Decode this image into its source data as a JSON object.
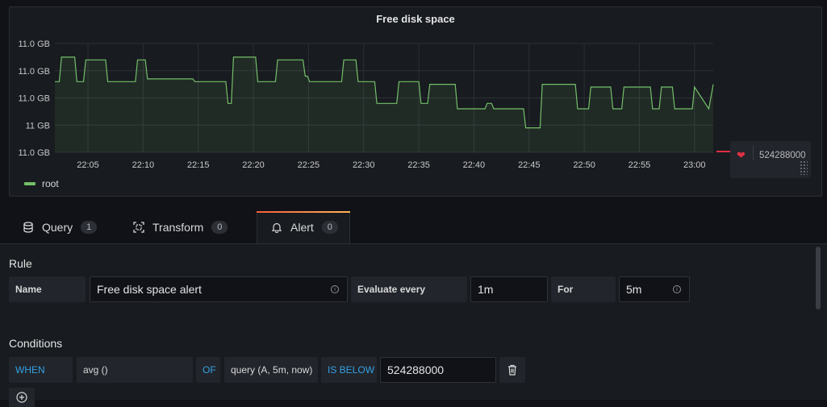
{
  "panel": {
    "title": "Free disk space"
  },
  "chart_data": {
    "type": "area",
    "title": "Free disk space",
    "y_tick_labels": [
      "11.0 GB",
      "11.0 GB",
      "11.0 GB",
      "11 GB",
      "11.0 GB"
    ],
    "x_tick_labels": [
      "22:05",
      "22:10",
      "22:15",
      "22:20",
      "22:25",
      "22:30",
      "22:35",
      "22:40",
      "22:45",
      "22:50",
      "22:55",
      "23:00"
    ],
    "x_range": [
      "22:02",
      "23:01"
    ],
    "ylim": [
      0,
      4
    ],
    "grid": true,
    "legend_position": "bottom-left",
    "series": [
      {
        "name": "root",
        "color": "#73bf69",
        "x_minutes": [
          0,
          0.4,
          0.6,
          1.8,
          2,
          2.6,
          2.8,
          4.6,
          4.8,
          7.3,
          7.5,
          8.2,
          8.4,
          12.5,
          12.7,
          15.5,
          15.7,
          16,
          16.2,
          18.2,
          18.4,
          20,
          20.2,
          22.5,
          22.7,
          22.9,
          23.1,
          26,
          26.2,
          27.3,
          27.5,
          29,
          29.2,
          31,
          31.2,
          33,
          33.2,
          33.8,
          34,
          36.3,
          36.5,
          39,
          39.2,
          39.6,
          39.8,
          42.5,
          42.7,
          44,
          44.2,
          47.2,
          47.4,
          48.4,
          48.6,
          50.4,
          50.6,
          51.4,
          51.6,
          54,
          54.2,
          54.8,
          55,
          56,
          56.2,
          57.8,
          58,
          59.3,
          59.7
        ],
        "values": [
          2.6,
          2.6,
          3.5,
          3.5,
          2.6,
          2.6,
          3.4,
          3.4,
          2.6,
          2.6,
          3.4,
          3.4,
          2.7,
          2.7,
          2.6,
          2.6,
          1.8,
          1.8,
          3.5,
          3.5,
          2.6,
          2.6,
          3.4,
          3.4,
          2.8,
          2.8,
          2.6,
          2.6,
          3.4,
          3.4,
          2.6,
          2.6,
          1.8,
          1.8,
          2.6,
          2.6,
          1.8,
          1.8,
          2.5,
          2.5,
          1.6,
          1.6,
          1.8,
          1.8,
          1.6,
          1.6,
          0.9,
          0.9,
          2.5,
          2.5,
          1.6,
          1.6,
          2.4,
          2.4,
          1.6,
          1.6,
          2.4,
          2.4,
          1.6,
          1.6,
          2.4,
          2.4,
          1.6,
          1.6,
          2.4,
          1.6,
          2.5
        ]
      }
    ],
    "threshold": {
      "value": "524288000",
      "color": "#e02f44"
    }
  },
  "legend": {
    "label": "root"
  },
  "threshold_handle": {
    "value": "524288000"
  },
  "tabs": [
    {
      "label": "Query",
      "count": "1"
    },
    {
      "label": "Transform",
      "count": "0"
    },
    {
      "label": "Alert",
      "count": "0"
    }
  ],
  "rule": {
    "section_title": "Rule",
    "name_label": "Name",
    "name_value": "Free disk space alert",
    "evaluate_label": "Evaluate every",
    "evaluate_value": "1m",
    "for_label": "For",
    "for_value": "5m"
  },
  "conditions": {
    "section_title": "Conditions",
    "when": "WHEN",
    "reducer": "avg ()",
    "of": "OF",
    "query": "query (A, 5m, now)",
    "evaluator": "IS BELOW",
    "threshold_value": "524288000"
  }
}
